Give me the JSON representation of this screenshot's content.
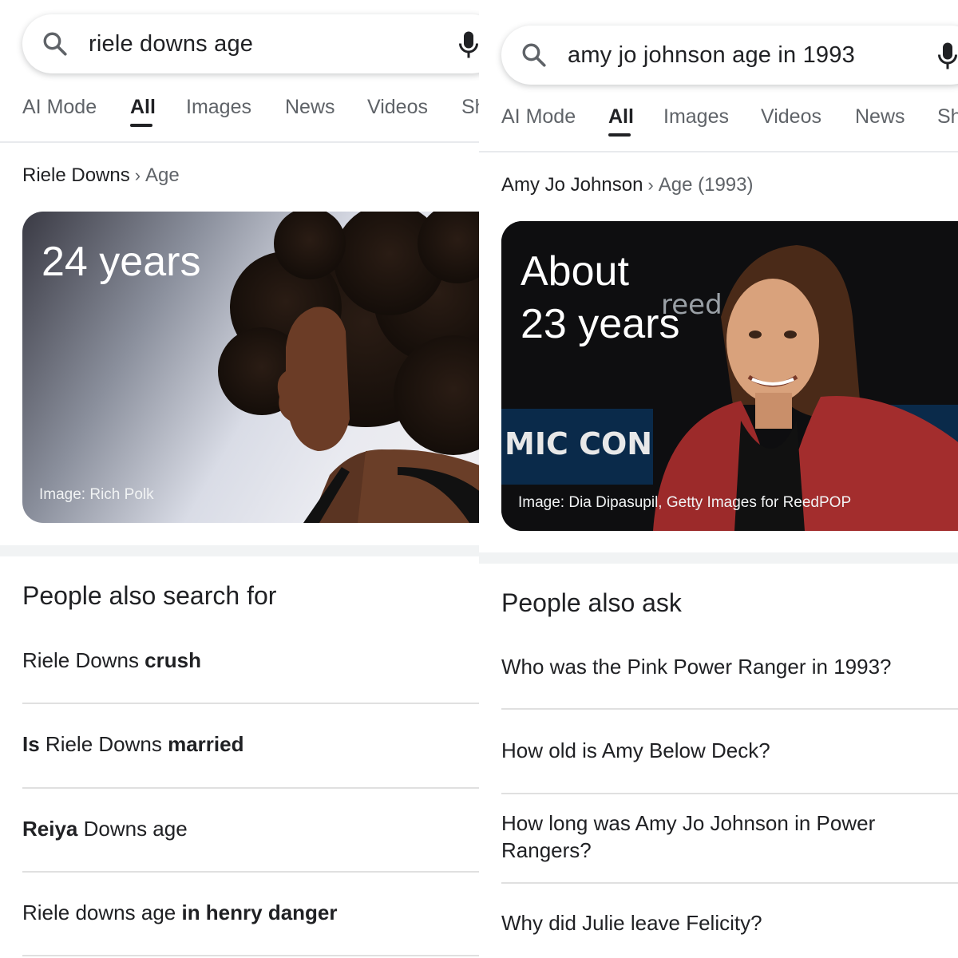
{
  "left": {
    "search": {
      "query": "riele downs age"
    },
    "tabs": [
      "AI Mode",
      "All",
      "Images",
      "News",
      "Videos",
      "Sh"
    ],
    "active_tab": "All",
    "breadcrumb": {
      "entity": "Riele Downs",
      "attribute": "Age"
    },
    "answer": {
      "value": "24 years",
      "credit": "Image: Rich Polk"
    },
    "section_title": "People also search for",
    "suggestions": [
      {
        "parts": [
          {
            "text": "Riele Downs ",
            "bold": false
          },
          {
            "text": "crush",
            "bold": true
          }
        ]
      },
      {
        "parts": [
          {
            "text": "Is",
            "bold": true
          },
          {
            "text": " Riele Downs ",
            "bold": false
          },
          {
            "text": "married",
            "bold": true
          }
        ]
      },
      {
        "parts": [
          {
            "text": "Reiya",
            "bold": true
          },
          {
            "text": " Downs age",
            "bold": false
          }
        ]
      },
      {
        "parts": [
          {
            "text": "Riele downs age ",
            "bold": false
          },
          {
            "text": "in henry danger",
            "bold": true
          }
        ]
      }
    ]
  },
  "right": {
    "search": {
      "query": "amy jo johnson age in 1993"
    },
    "tabs": [
      "AI Mode",
      "All",
      "Images",
      "Videos",
      "News",
      "Sh"
    ],
    "active_tab": "All",
    "breadcrumb": {
      "entity": "Amy Jo Johnson",
      "attribute": "Age (1993)"
    },
    "answer": {
      "line1": "About",
      "line2": "23 years",
      "credit": "Image: Dia Dipasupil, Getty Images for ReedPOP"
    },
    "backdrop_text": {
      "left": "MIC CON",
      "brand": "reed"
    },
    "section_title": "People also ask",
    "questions": [
      "Who was the Pink Power Ranger in 1993?",
      "How old is Amy Below Deck?",
      "How long was Amy Jo Johnson in Power Rangers?",
      "Why did Julie leave Felicity?"
    ]
  },
  "icons": {
    "search": "search-icon",
    "mic": "microphone-icon"
  },
  "colors": {
    "text": "#202124",
    "muted": "#5f6368",
    "divider": "#e0e0e0",
    "section_bg": "#f1f3f4"
  }
}
